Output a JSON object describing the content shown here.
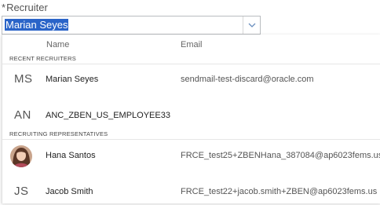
{
  "field": {
    "required_mark": "*",
    "label": "Recruiter",
    "value": "Marian Seyes"
  },
  "columns": {
    "name": "Name",
    "email": "Email"
  },
  "groups": [
    {
      "title": "RECENT RECRUITERS",
      "rows": [
        {
          "initials": "MS",
          "name": "Marian Seyes",
          "email": "sendmail-test-discard@oracle.com"
        },
        {
          "initials": "AN",
          "name": "ANC_ZBEN_US_EMPLOYEE33",
          "email": ""
        }
      ]
    },
    {
      "title": "RECRUITING REPRESENTATIVES",
      "rows": [
        {
          "initials": "",
          "avatar": "person-photo",
          "name": "Hana Santos",
          "email": "FRCE_test25+ZBENHana_387084@ap6023fems.us"
        },
        {
          "initials": "JS",
          "name": "Jacob Smith",
          "email": "FRCE_test22+jacob.smith+ZBEN@ap6023fems.us"
        }
      ]
    }
  ],
  "icons": {
    "dropdown": "chevron-down-icon"
  },
  "colors": {
    "selection": "#2a64c8",
    "chevron": "#6b8fbf"
  }
}
